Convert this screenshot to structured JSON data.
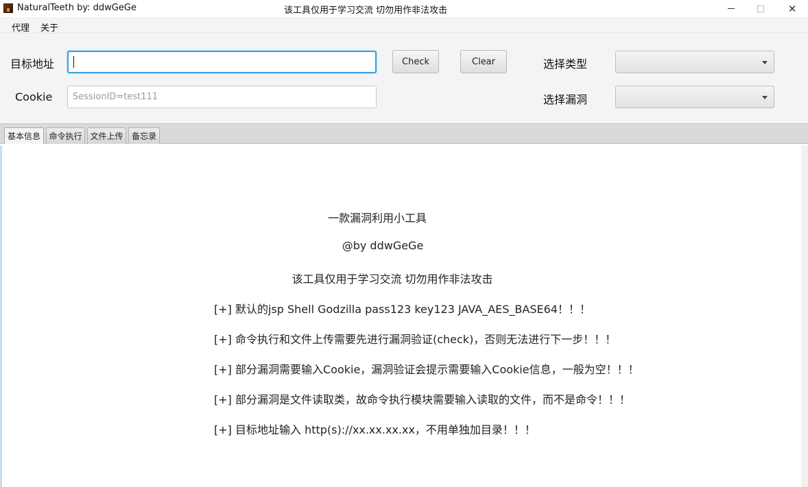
{
  "window": {
    "title": "NaturalTeeth  by: ddwGeGe",
    "center_title": "该工具仅用于学习交流 切勿用作非法攻击",
    "minimize": "—",
    "close": "✕"
  },
  "menu": {
    "items": [
      "代理",
      "关于"
    ]
  },
  "form": {
    "target_label": "目标地址",
    "target_value": "",
    "cookie_label": "Cookie",
    "cookie_placeholder": "SessionID=test111",
    "check_label": "Check",
    "clear_label": "Clear",
    "type_label": "选择类型",
    "type_value": "",
    "vuln_label": "选择漏洞",
    "vuln_value": ""
  },
  "tabs": [
    "基本信息",
    "命令执行",
    "文件上传",
    "备忘录"
  ],
  "active_tab": 0,
  "content": {
    "lines": [
      "一款漏洞利用小工具",
      "@by ddwGeGe",
      "该工具仅用于学习交流 切勿用作非法攻击",
      "[+] 默认的jsp Shell Godzilla pass123 key123 JAVA_AES_BASE64！！！",
      "[+] 命令执行和文件上传需要先进行漏洞验证(check)，否则无法进行下一步！！！",
      "[+] 部分漏洞需要输入Cookie，漏洞验证会提示需要输入Cookie信息，一般为空！！！",
      "[+] 部分漏洞是文件读取类，故命令执行模块需要输入读取的文件，而不是命令！！！",
      "[+] 目标地址输入 http(s)://xx.xx.xx.xx，不用单独加目录！！！"
    ]
  },
  "colors": {
    "focus_border": "#3aa0e0",
    "content_left_border": "#6ea9d8"
  }
}
